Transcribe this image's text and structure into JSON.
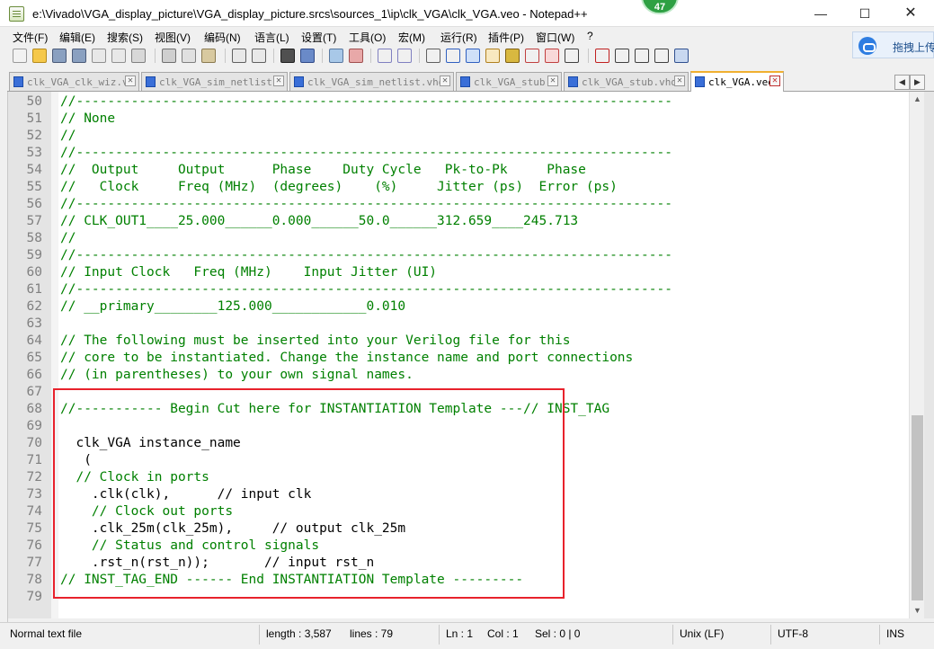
{
  "window": {
    "title": "e:\\Vivado\\VGA_display_picture\\VGA_display_picture.srcs\\sources_1\\ip\\clk_VGA\\clk_VGA.veo - Notepad++",
    "notification_count": "47",
    "minimize_glyph": "—",
    "maximize_glyph": "☐",
    "close_glyph": "✕"
  },
  "menu": [
    "文件(F)",
    "编辑(E)",
    "搜索(S)",
    "视图(V)",
    "编码(N)",
    "语言(L)",
    "设置(T)",
    "工具(O)",
    "宏(M)",
    "运行(R)",
    "插件(P)",
    "窗口(W)",
    "?"
  ],
  "baidu_button": {
    "label": "拖拽上传",
    "icon": "cloud-icon"
  },
  "tabs": [
    {
      "label": "clk_VGA_clk_wiz.v",
      "active": false
    },
    {
      "label": "clk_VGA_sim_netlist.v",
      "active": false
    },
    {
      "label": "clk_VGA_sim_netlist.vhdl",
      "active": false
    },
    {
      "label": "clk_VGA_stub.v",
      "active": false
    },
    {
      "label": "clk_VGA_stub.vhdl",
      "active": false
    },
    {
      "label": "clk_VGA.veo",
      "active": true
    }
  ],
  "tab_close_glyph": "✕",
  "tab_scroll": {
    "left": "◀",
    "right": "▶"
  },
  "editor": {
    "lines": [
      {
        "num": "50",
        "text": "//----------------------------------------------------------------------------"
      },
      {
        "num": "51",
        "text": "// None"
      },
      {
        "num": "52",
        "text": "//"
      },
      {
        "num": "53",
        "text": "//----------------------------------------------------------------------------"
      },
      {
        "num": "54",
        "text": "//  Output     Output      Phase    Duty Cycle   Pk-to-Pk     Phase"
      },
      {
        "num": "55",
        "text": "//   Clock     Freq (MHz)  (degrees)    (%)     Jitter (ps)  Error (ps)"
      },
      {
        "num": "56",
        "text": "//----------------------------------------------------------------------------"
      },
      {
        "num": "57",
        "text": "// CLK_OUT1____25.000______0.000______50.0______312.659____245.713"
      },
      {
        "num": "58",
        "text": "//"
      },
      {
        "num": "59",
        "text": "//----------------------------------------------------------------------------"
      },
      {
        "num": "60",
        "text": "// Input Clock   Freq (MHz)    Input Jitter (UI)"
      },
      {
        "num": "61",
        "text": "//----------------------------------------------------------------------------"
      },
      {
        "num": "62",
        "text": "// __primary________125.000____________0.010"
      },
      {
        "num": "63",
        "text": ""
      },
      {
        "num": "64",
        "text": "// The following must be inserted into your Verilog file for this"
      },
      {
        "num": "65",
        "text": "// core to be instantiated. Change the instance name and port connections"
      },
      {
        "num": "66",
        "text": "// (in parentheses) to your own signal names."
      },
      {
        "num": "67",
        "text": ""
      },
      {
        "num": "68",
        "text": "//----------- Begin Cut here for INSTANTIATION Template ---// INST_TAG"
      },
      {
        "num": "69",
        "text": ""
      },
      {
        "num": "70",
        "text": "  clk_VGA instance_name"
      },
      {
        "num": "71",
        "text": "   ("
      },
      {
        "num": "72",
        "text": "  // Clock in ports"
      },
      {
        "num": "73",
        "text": "    .clk(clk),      // input clk"
      },
      {
        "num": "74",
        "text": "    // Clock out ports"
      },
      {
        "num": "75",
        "text": "    .clk_25m(clk_25m),     // output clk_25m"
      },
      {
        "num": "76",
        "text": "    // Status and control signals"
      },
      {
        "num": "77",
        "text": "    .rst_n(rst_n));       // input rst_n"
      },
      {
        "num": "78",
        "text": "// INST_TAG_END ------ End INSTANTIATION Template ---------"
      },
      {
        "num": "79",
        "text": ""
      }
    ],
    "line_colors": {
      "line_numbers": "#808080",
      "comment": "#008000",
      "code": "#000000"
    }
  },
  "scrollbar": {
    "up": "▲",
    "down": "▼"
  },
  "status": {
    "file_type": "Normal text file",
    "length": "length : 3,587",
    "lines": "lines : 79",
    "ln": "Ln : 1",
    "col": "Col : 1",
    "sel": "Sel : 0 | 0",
    "eol": "Unix (LF)",
    "encoding": "UTF-8",
    "mode": "INS"
  },
  "colors": {
    "highlight_box": "#e8222c",
    "active_tab_accent": "#f0b030",
    "comment_green": "#008000"
  }
}
